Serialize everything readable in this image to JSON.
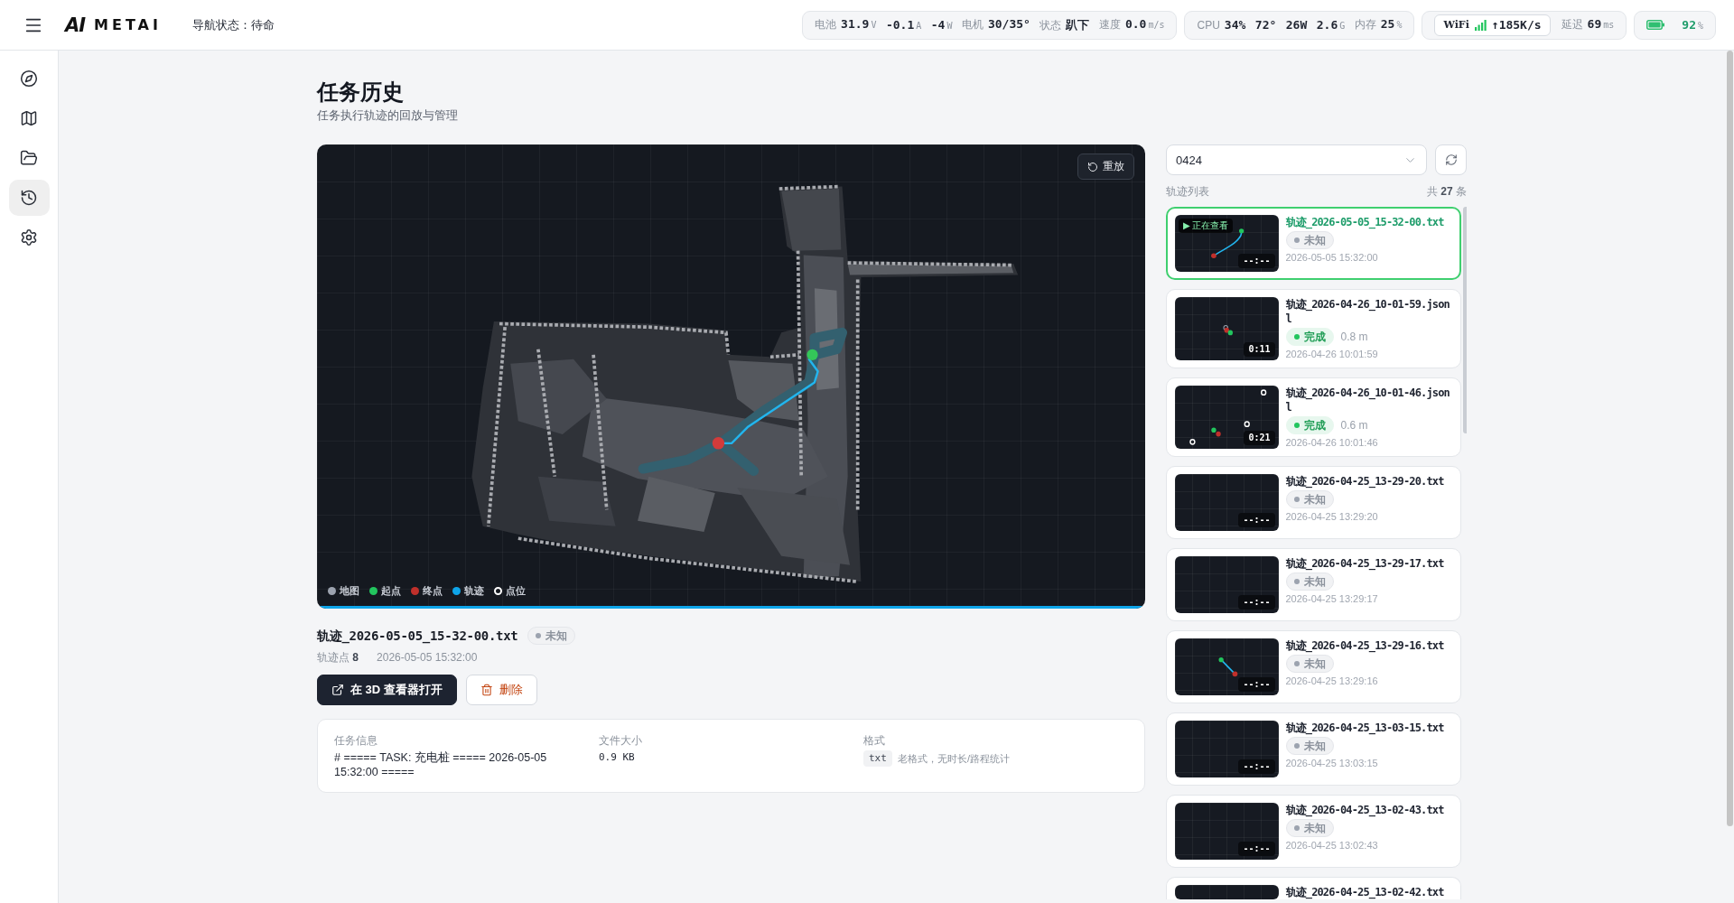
{
  "header": {
    "logo": {
      "mark": "AI",
      "name": "METAI"
    },
    "nav_status": "导航状态：待命",
    "stats": [
      {
        "kind": "metrics",
        "items": [
          {
            "label": "电池",
            "value": "31.9",
            "unit": "V"
          },
          {
            "value": "-0.1",
            "unit": "A"
          },
          {
            "value": "-4",
            "unit": "W"
          },
          {
            "label": "电机",
            "value": "30/35°"
          },
          {
            "label": "状态",
            "value": "趴下"
          },
          {
            "label": "速度",
            "value": "0.0",
            "unit": "m/s"
          }
        ]
      },
      {
        "kind": "metrics",
        "items": [
          {
            "label": "CPU",
            "value": "34%"
          },
          {
            "value": "72°"
          },
          {
            "value": "26W"
          },
          {
            "value": "2.6",
            "unit": "G"
          },
          {
            "label": "内存",
            "value": "25",
            "unit": "%"
          }
        ]
      },
      {
        "kind": "network",
        "wifi": {
          "label": "WiFi",
          "rate": "↑185K/s"
        },
        "items": [
          {
            "label": "延迟",
            "value": "69",
            "unit": "ms"
          }
        ]
      },
      {
        "kind": "battery",
        "items": [
          {
            "value": "92",
            "unit": "%"
          }
        ]
      }
    ]
  },
  "sidebar": {
    "items": [
      {
        "selected": false
      },
      {
        "selected": false
      },
      {
        "selected": false
      },
      {
        "selected": true
      },
      {
        "selected": false
      }
    ]
  },
  "page": {
    "title": "任务历史",
    "subtitle": "任务执行轨迹的回放与管理"
  },
  "viewer": {
    "replay_button": "重放",
    "legend": [
      {
        "label": "地图",
        "color": "#9ca3af",
        "kind": "dot"
      },
      {
        "label": "起点",
        "color": "#22c55e",
        "kind": "dot"
      },
      {
        "label": "终点",
        "color": "#c0302b",
        "kind": "dot"
      },
      {
        "label": "轨迹",
        "color": "#0ea5e9",
        "kind": "dot"
      },
      {
        "label": "点位",
        "color": "#ffffff",
        "kind": "ring"
      }
    ],
    "progress": {
      "level": 1
    }
  },
  "selected_file": {
    "name": "轨迹_2026-05-05_15-32-00.txt",
    "status": {
      "label": "未知",
      "kind": "unknown"
    },
    "points": "轨迹点 **8**",
    "time": "2026-05-05 15:32:00",
    "actions": [
      {
        "label": "在 3D 查看器打开",
        "kind": "primary"
      },
      {
        "label": "删除",
        "kind": "danger"
      }
    ],
    "info": [
      {
        "kind": "text",
        "label": "任务信息",
        "value": "# ===== TASK: 充电桩 ===== 2026-05-05 15:32:00 ====="
      },
      {
        "kind": "mono",
        "label": "文件大小",
        "value": "0.9 KB"
      },
      {
        "kind": "format",
        "label": "格式",
        "tag": "txt",
        "note": "老格式，无时长/路程统计"
      }
    ]
  },
  "track_list": {
    "filter": {
      "value": "0424"
    },
    "title": "轨迹列表",
    "count": "共 **27** 条",
    "items": [
      {
        "name": "轨迹_2026-05-05_15-32-00.txt",
        "selected": true,
        "viewing_badge": "▶ 正在查看",
        "duration": "--:--",
        "status": {
          "label": "未知",
          "kind": "unknown"
        },
        "time": "2026-05-05 15:32:00"
      },
      {
        "name": "轨迹_2026-04-26_10-01-59.jsonl",
        "selected": false,
        "duration": "0:11",
        "status": {
          "label": "完成",
          "kind": "done"
        },
        "distance": "0.8 m",
        "time": "2026-04-26 10:01:59"
      },
      {
        "name": "轨迹_2026-04-26_10-01-46.jsonl",
        "selected": false,
        "duration": "0:21",
        "status": {
          "label": "完成",
          "kind": "done"
        },
        "distance": "0.6 m",
        "time": "2026-04-26 10:01:46"
      },
      {
        "name": "轨迹_2026-04-25_13-29-20.txt",
        "selected": false,
        "duration": "--:--",
        "status": {
          "label": "未知",
          "kind": "unknown"
        },
        "time": "2026-04-25 13:29:20"
      },
      {
        "name": "轨迹_2026-04-25_13-29-17.txt",
        "selected": false,
        "duration": "--:--",
        "status": {
          "label": "未知",
          "kind": "unknown"
        },
        "time": "2026-04-25 13:29:17"
      },
      {
        "name": "轨迹_2026-04-25_13-29-16.txt",
        "selected": false,
        "duration": "--:--",
        "status": {
          "label": "未知",
          "kind": "unknown"
        },
        "time": "2026-04-25 13:29:16"
      },
      {
        "name": "轨迹_2026-04-25_13-03-15.txt",
        "selected": false,
        "duration": "--:--",
        "status": {
          "label": "未知",
          "kind": "unknown"
        },
        "time": "2026-04-25 13:03:15"
      },
      {
        "name": "轨迹_2026-04-25_13-02-43.txt",
        "selected": false,
        "duration": "--:--",
        "status": {
          "label": "未知",
          "kind": "unknown"
        },
        "time": "2026-04-25 13:02:43"
      },
      {
        "name": "轨迹_2026-04-25_13-02-42.txt",
        "selected": false
      }
    ]
  }
}
